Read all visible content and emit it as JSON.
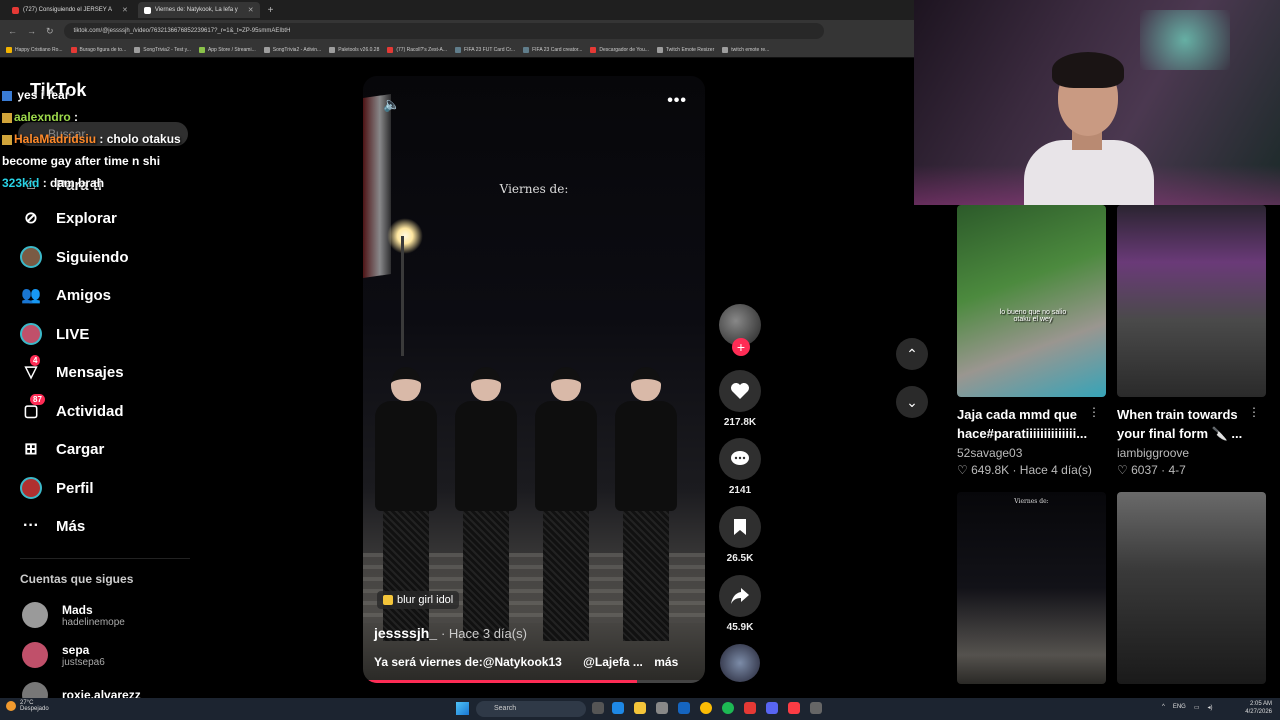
{
  "browser": {
    "tabs": [
      {
        "label": "(727) Consiguiendo el JERSEY A",
        "color": "#e53935",
        "active": false
      },
      {
        "label": "Viernes de: Natykook, La lefa y",
        "color": "#ffffff",
        "active": true
      }
    ],
    "url": "tiktok.com/@jessssjh_/video/7632136676852239617?_r=1&_t=ZP-95smmAEIbtH",
    "bookmarks": [
      {
        "label": "Happy Cristiano Ro...",
        "color": "#f4b400"
      },
      {
        "label": "Burago figura de to...",
        "color": "#e53935"
      },
      {
        "label": "SongTrivia2 - Test y...",
        "color": "#9e9e9e"
      },
      {
        "label": "App Store / Streami...",
        "color": "#8bc34a"
      },
      {
        "label": "SongTrivia2 - Adivin...",
        "color": "#9e9e9e"
      },
      {
        "label": "Paletools v26.0.28",
        "color": "#9e9e9e"
      },
      {
        "label": "(77) Racoll?'s Zest-A...",
        "color": "#e53935"
      },
      {
        "label": "FIFA 23 FUT Card Cr...",
        "color": "#607d8b"
      },
      {
        "label": "FIFA 23 Card creator...",
        "color": "#607d8b"
      },
      {
        "label": "Descargador de You...",
        "color": "#e53935"
      },
      {
        "label": "Twitch Emote Resizer",
        "color": "#9e9e9e"
      },
      {
        "label": "twitch emote re...",
        "color": "#9e9e9e"
      }
    ]
  },
  "sidebar": {
    "logo": "TikTok",
    "search_placeholder": "Buscar",
    "items": [
      {
        "label": "Para ti",
        "icon": "home-icon"
      },
      {
        "label": "Explorar",
        "icon": "compass-icon"
      },
      {
        "label": "Siguiendo",
        "icon": "following-avatar-icon"
      },
      {
        "label": "Amigos",
        "icon": "friends-icon"
      },
      {
        "label": "LIVE",
        "icon": "live-icon"
      },
      {
        "label": "Mensajes",
        "icon": "messages-icon",
        "badge": "4"
      },
      {
        "label": "Actividad",
        "icon": "activity-icon",
        "badge": "87"
      },
      {
        "label": "Cargar",
        "icon": "upload-icon"
      },
      {
        "label": "Perfil",
        "icon": "profile-icon"
      },
      {
        "label": "Más",
        "icon": "more-icon"
      }
    ],
    "following_title": "Cuentas que sigues",
    "following": [
      {
        "name": "Mads",
        "handle": "hadelinemope",
        "color": "#9a9a9a"
      },
      {
        "name": "sepa",
        "handle": "justsepa6",
        "color": "#c0506a"
      },
      {
        "name": "roxie.alvarezz",
        "handle": "",
        "color": "#777777"
      }
    ]
  },
  "chat": [
    {
      "user": "",
      "text": "yes i fear"
    },
    {
      "user": "aalexndro",
      "text": ":"
    },
    {
      "user": "HalaMadridsiu",
      "text": ": cholo otakus become gay after time n shi"
    },
    {
      "user": "323kid",
      "text": ": dam brah"
    }
  ],
  "video": {
    "overlay_text": "Viernes de:",
    "tag": "blur girl idol",
    "author": "jessssjh_",
    "time": "· Hace 3 día(s)",
    "description": "Ya será viernes de:@Natykook13",
    "description_mention": "@Lajefa ...",
    "more_label": "más",
    "progress": 0.8
  },
  "actions": [
    {
      "icon": "heart-icon",
      "count": "217.8K"
    },
    {
      "icon": "comment-icon",
      "count": "2141"
    },
    {
      "icon": "bookmark-icon",
      "count": "26.5K"
    },
    {
      "icon": "share-icon",
      "count": "45.9K"
    }
  ],
  "recommendations": [
    {
      "title": "Jaja cada mmd que hace#paratiiiiiiiiiiiiii...",
      "user": "52savage03",
      "meta": "649.8K · Hace 4 día(s)",
      "thumb_text": "lo bueno que no salio otaku el wey"
    },
    {
      "title": "When train towards your final form 🔪 ...",
      "user": "iambiggroove",
      "meta": "6037 · 4-7",
      "thumb_text": ""
    },
    {
      "title": "",
      "user": "",
      "meta": "",
      "thumb_text": "Viernes de:"
    },
    {
      "title": "",
      "user": "",
      "meta": "",
      "thumb_text": ""
    }
  ],
  "taskbar": {
    "weather_temp": "27°C",
    "weather_desc": "Despejado",
    "search": "Search",
    "lang": "ENG",
    "time": "2:05 AM",
    "date": "4/27/2026"
  }
}
